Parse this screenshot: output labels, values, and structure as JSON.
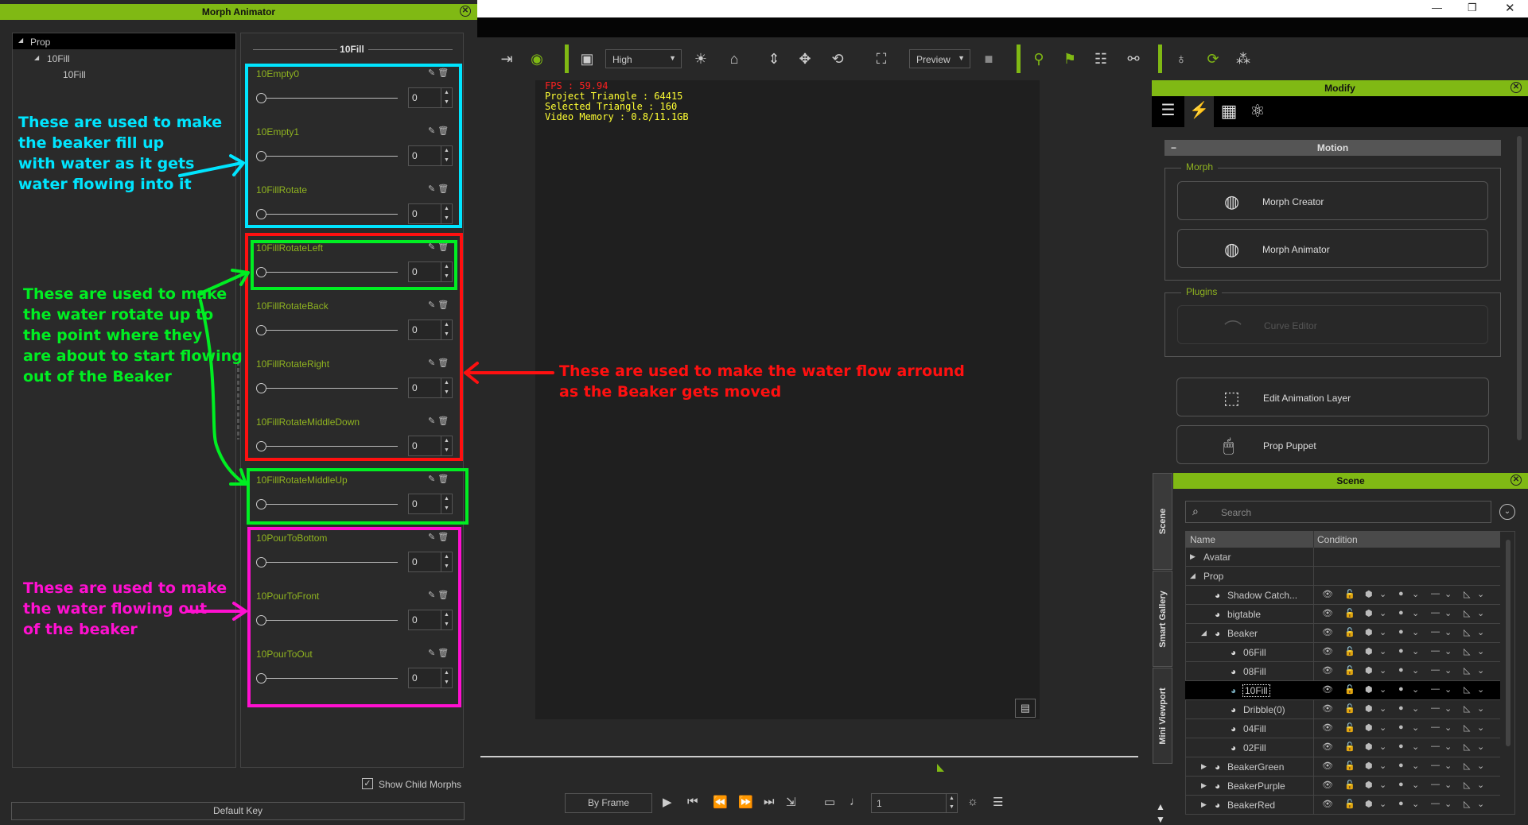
{
  "morph_animator": {
    "title": "Morph Animator",
    "tree": [
      {
        "label": "Prop",
        "expander": "◢"
      },
      {
        "label": "10Fill",
        "expander": "◢"
      },
      {
        "label": "10Fill",
        "expander": ""
      }
    ],
    "group_header": "10Fill",
    "morphs": [
      {
        "name": "10Empty0",
        "value": "0"
      },
      {
        "name": "10Empty1",
        "value": "0"
      },
      {
        "name": "10FillRotate",
        "value": "0"
      },
      {
        "name": "10FillRotateLeft",
        "value": "0"
      },
      {
        "name": "10FillRotateBack",
        "value": "0"
      },
      {
        "name": "10FillRotateRight",
        "value": "0"
      },
      {
        "name": "10FillRotateMiddleDown",
        "value": "0"
      },
      {
        "name": "10FillRotateMiddleUp",
        "value": "0"
      },
      {
        "name": "10PourToBottom",
        "value": "0"
      },
      {
        "name": "10PourToFront",
        "value": "0"
      },
      {
        "name": "10PourToOut",
        "value": "0"
      }
    ],
    "show_child_morphs_label": "Show Child Morphs",
    "show_child_morphs_checked": true,
    "default_key_label": "Default Key"
  },
  "annotations": {
    "cyan": {
      "color": "#00e5ff",
      "lines": [
        "These are used to make",
        "the beaker fill up",
        "with water as it gets",
        "water flowing into it"
      ]
    },
    "green": {
      "color": "#00ee22",
      "lines": [
        "These are used to make",
        "the water rotate up to",
        "the point where they",
        "are about to start flowing",
        "out of the Beaker"
      ]
    },
    "red": {
      "color": "#ff1010",
      "lines": [
        "These are used to make the water flow arround",
        "as the Beaker gets moved"
      ]
    },
    "magenta": {
      "color": "#ff10d0",
      "lines": [
        "These are used to make",
        "the water flowing out",
        "of the beaker"
      ]
    }
  },
  "toolbar": {
    "quality_select": "High",
    "render_select": "Preview"
  },
  "viewport": {
    "fps": "FPS : 59.94",
    "project_triangle": "Project Triangle : 64415",
    "selected_triangle": "Selected Triangle : 160",
    "video_memory": "Video Memory : 0.8/11.1GB"
  },
  "playback": {
    "mode_button": "By Frame",
    "frame_value": "1"
  },
  "modify": {
    "title": "Modify",
    "section": "Motion",
    "morph_group": "Morph",
    "morph_creator": "Morph Creator",
    "morph_animator": "Morph Animator",
    "plugins_group": "Plugins",
    "curve_editor": "Curve Editor",
    "edit_animation_layer": "Edit Animation Layer",
    "prop_puppet": "Prop Puppet"
  },
  "scene": {
    "title": "Scene",
    "search_placeholder": "Search",
    "col_name": "Name",
    "col_condition": "Condition",
    "side_tabs": [
      "Scene",
      "Smart Gallery",
      "Mini Viewport"
    ],
    "rows": [
      {
        "name": "Avatar",
        "level": 0,
        "expander": "▶",
        "node": false,
        "selected": false
      },
      {
        "name": "Prop",
        "level": 0,
        "expander": "◢",
        "node": false,
        "selected": false
      },
      {
        "name": "Shadow Catch...",
        "level": 1,
        "expander": "",
        "node": true,
        "selected": false
      },
      {
        "name": "bigtable",
        "level": 1,
        "expander": "",
        "node": true,
        "selected": false
      },
      {
        "name": "Beaker",
        "level": 1,
        "expander": "◢",
        "node": true,
        "selected": false
      },
      {
        "name": "06Fill",
        "level": 2,
        "expander": "",
        "node": true,
        "selected": false
      },
      {
        "name": "08Fill",
        "level": 2,
        "expander": "",
        "node": true,
        "selected": false
      },
      {
        "name": "10Fill",
        "level": 2,
        "expander": "",
        "node": true,
        "selected": true
      },
      {
        "name": "Dribble(0)",
        "level": 2,
        "expander": "",
        "node": true,
        "selected": false
      },
      {
        "name": "04Fill",
        "level": 2,
        "expander": "",
        "node": true,
        "selected": false
      },
      {
        "name": "02Fill",
        "level": 2,
        "expander": "",
        "node": true,
        "selected": false
      },
      {
        "name": "BeakerGreen",
        "level": 1,
        "expander": "▶",
        "node": true,
        "selected": false
      },
      {
        "name": "BeakerPurple",
        "level": 1,
        "expander": "▶",
        "node": true,
        "selected": false
      },
      {
        "name": "BeakerRed",
        "level": 1,
        "expander": "▶",
        "node": true,
        "selected": false
      }
    ]
  },
  "colors": {
    "accent": "#80b914",
    "morph_label": "#8fb320"
  }
}
